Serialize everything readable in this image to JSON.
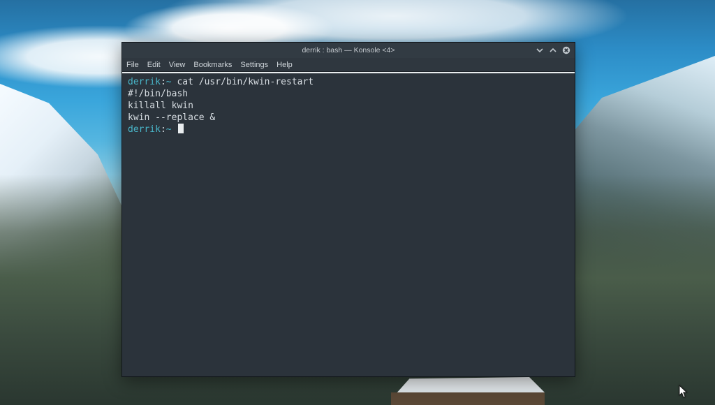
{
  "window": {
    "title": "derrik : bash — Konsole <4>"
  },
  "menubar": {
    "items": [
      "File",
      "Edit",
      "View",
      "Bookmarks",
      "Settings",
      "Help"
    ]
  },
  "prompt": {
    "user": "derrik",
    "sep": ":",
    "path": "~"
  },
  "terminal": {
    "command1": "cat /usr/bin/kwin-restart",
    "line1": "#!/bin/bash",
    "line2": "killall kwin",
    "line3": "kwin --replace &"
  },
  "controls": {
    "minimize": "Minimize",
    "maximize": "Maximize",
    "close": "Close"
  }
}
